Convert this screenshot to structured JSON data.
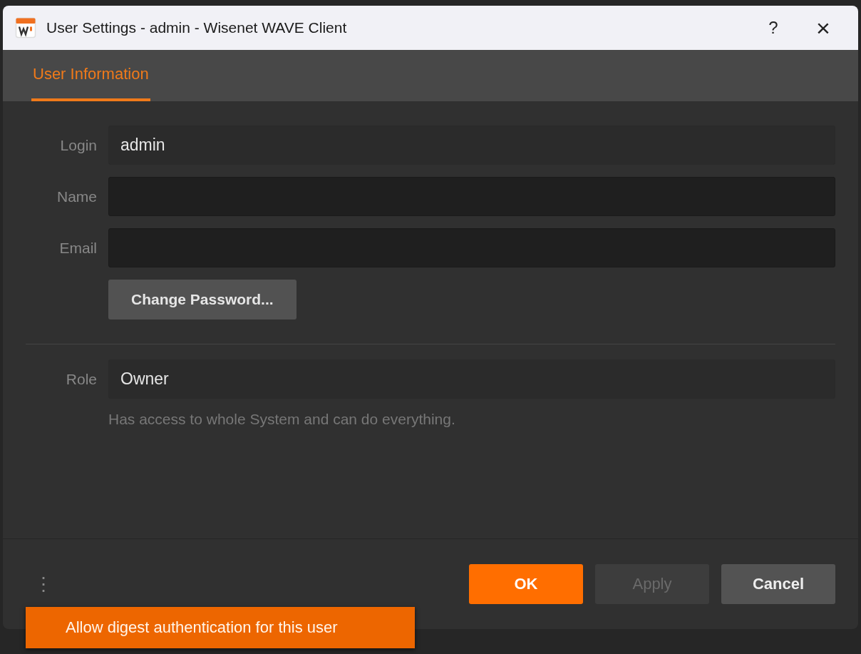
{
  "window": {
    "title": "User Settings - admin - Wisenet WAVE Client",
    "help": "?",
    "close": "×"
  },
  "tabs": [
    {
      "label": "User Information",
      "selected": true
    }
  ],
  "fields": [
    {
      "label": "Login",
      "value": "admin",
      "editable": false
    },
    {
      "label": "Name",
      "editable": true
    },
    {
      "label": "Email",
      "editable": true
    }
  ],
  "change_password_button": {
    "label": "Change Password..."
  },
  "role": {
    "label": "Role",
    "value": "Owner",
    "description": "Has access to whole System and can do everything."
  },
  "buttons": [
    {
      "label": "OK",
      "kind": "primary",
      "disabled": false
    },
    {
      "label": "Apply",
      "kind": "default",
      "disabled": true
    },
    {
      "label": "Cancel",
      "kind": "default",
      "disabled": false
    }
  ],
  "menu_button": {
    "label": "⋮"
  },
  "popup_menu": {
    "items": [
      {
        "label": "Allow digest authentication for this user",
        "selected": true
      }
    ]
  }
}
